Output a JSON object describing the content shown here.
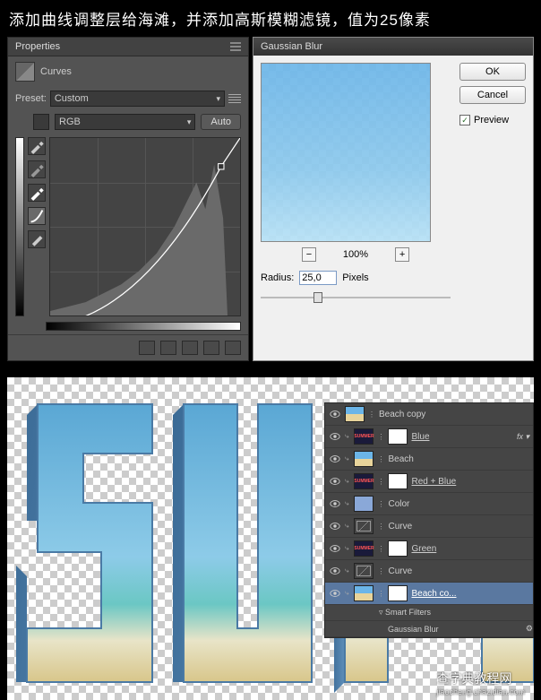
{
  "instruction": "添加曲线调整层给海滩，并添加高斯模糊滤镜，值为25像素",
  "properties": {
    "title": "Properties",
    "type": "Curves",
    "preset_label": "Preset:",
    "preset_value": "Custom",
    "channel": "RGB",
    "auto": "Auto"
  },
  "gaussian": {
    "title": "Gaussian Blur",
    "ok": "OK",
    "cancel": "Cancel",
    "preview": "Preview",
    "zoom": "100%",
    "radius_label": "Radius:",
    "radius_value": "25,0",
    "radius_unit": "Pixels"
  },
  "layers": [
    {
      "name": "Beach copy",
      "thumb": "beach",
      "underline": false
    },
    {
      "name": "Blue",
      "thumb": "summer",
      "mask": true,
      "underline": true,
      "fx": true,
      "arrow": true
    },
    {
      "name": "Beach",
      "thumb": "beach",
      "underline": false,
      "arrow": true
    },
    {
      "name": "Red + Blue",
      "thumb": "summer",
      "mask": true,
      "underline": true,
      "arrow": true
    },
    {
      "name": "Color",
      "thumb": "color",
      "underline": false,
      "arrow": true
    },
    {
      "name": "Curve",
      "thumb": "curve",
      "underline": false,
      "arrow": true
    },
    {
      "name": "Green",
      "thumb": "summer",
      "mask": true,
      "underline": true,
      "arrow": true
    },
    {
      "name": "Curve",
      "thumb": "curve",
      "underline": false,
      "arrow": true
    },
    {
      "name": "Beach co...",
      "thumb": "beach",
      "mask": true,
      "underline": true,
      "sel": true,
      "arrow": true
    }
  ],
  "smart_filters": "Smart Filters",
  "gblur_filter": "Gaussian Blur",
  "watermark": {
    "main": "查字典教程网",
    "sub": "jiaocheng.chazidian.com"
  }
}
